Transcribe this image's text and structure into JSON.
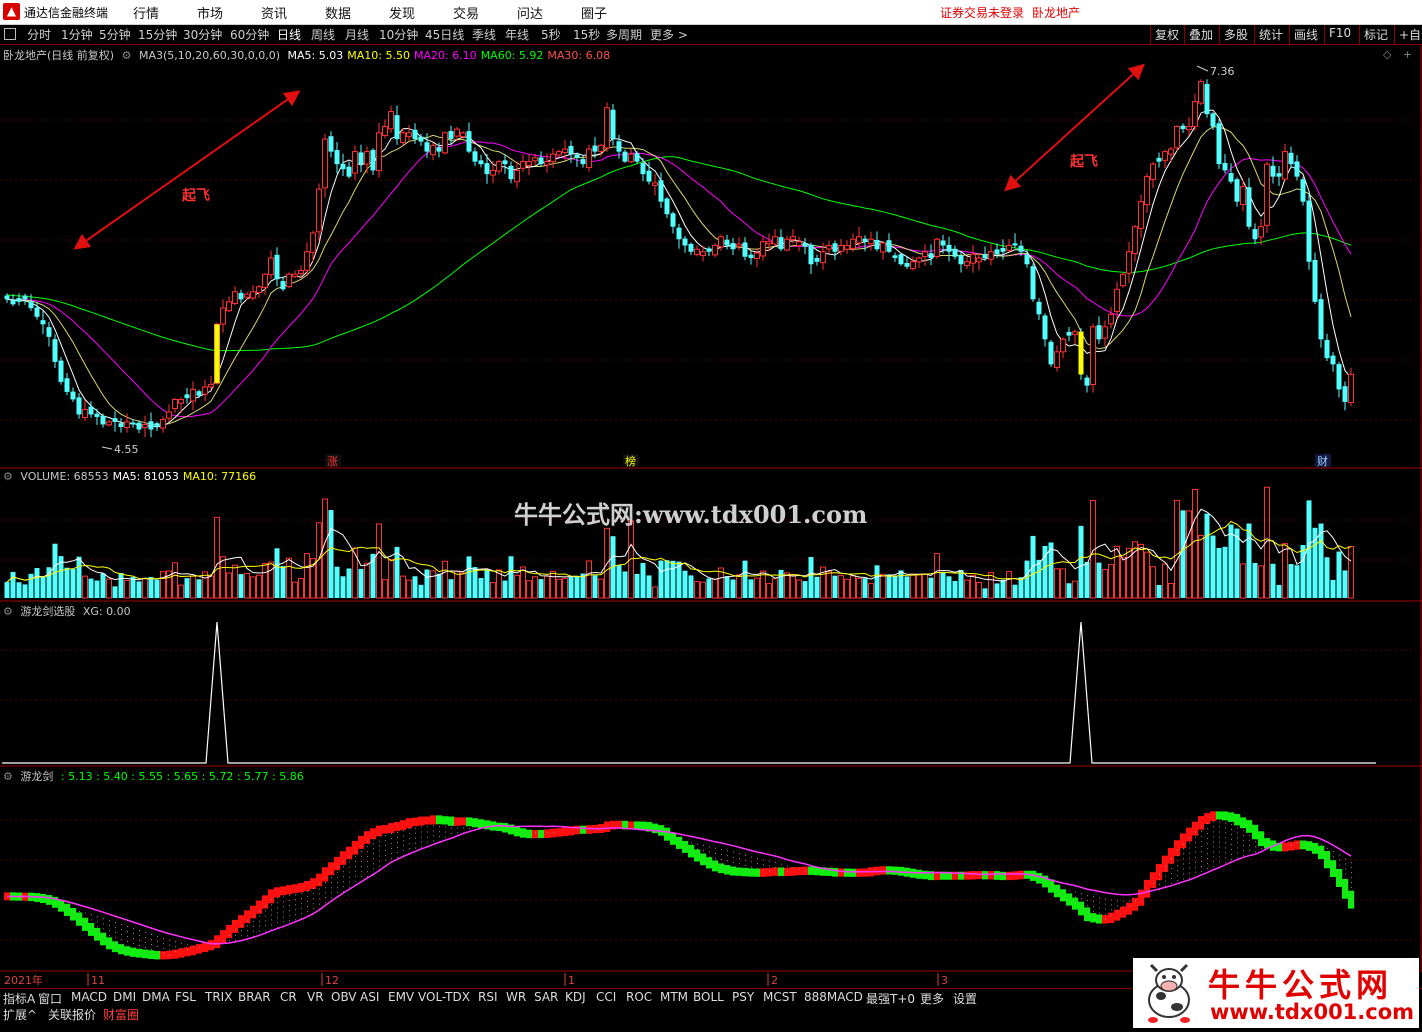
{
  "titlebar": {
    "app_name": "通达信金融终端",
    "menu": [
      "行情",
      "市场",
      "资讯",
      "数据",
      "发现",
      "交易",
      "问达",
      "圈子"
    ],
    "login_status": "证券交易未登录",
    "stock_name": "卧龙地产"
  },
  "toolbar": {
    "periods": [
      "分时",
      "1分钟",
      "5分钟",
      "15分钟",
      "30分钟",
      "60分钟",
      "日线",
      "周线",
      "月线",
      "10分钟",
      "45日线",
      "季线",
      "年线",
      "5秒",
      "15秒",
      "多周期",
      "更多 >"
    ],
    "active_period": "日线",
    "right": [
      "复权",
      "叠加",
      "多股",
      "统计",
      "画线",
      "F10",
      "标记",
      "+自选"
    ]
  },
  "main_legend": {
    "title": "卧龙地产(日线 前复权)",
    "ma_param": "MA3(5,10,20,60,30,0,0,0)",
    "items": [
      {
        "label": "MA5: 5.03",
        "color": "#ffffff"
      },
      {
        "label": "MA10: 5.50",
        "color": "#ffff00"
      },
      {
        "label": "MA20: 6.10",
        "color": "#ff00ff"
      },
      {
        "label": "MA60: 5.92",
        "color": "#00ff00"
      },
      {
        "label": "MA30: 6.08",
        "color": "#ff5050"
      }
    ]
  },
  "volume_legend": {
    "items": [
      {
        "label": "VOLUME: 68553",
        "color": "#c8c8c8"
      },
      {
        "label": "MA5: 81053",
        "color": "#ffffff"
      },
      {
        "label": "MA10: 77166",
        "color": "#ffff00"
      }
    ]
  },
  "xg_legend": {
    "label": "游龙剑选股",
    "value": "XG: 0.00"
  },
  "ylj_legend": {
    "label": "游龙剑",
    "values": ": 5.13 : 5.40 : 5.55 : 5.65 : 5.72 : 5.77 : 5.86"
  },
  "annotations": {
    "takeoff_1": "起飞",
    "takeoff_2": "起飞",
    "high_label": "7.36",
    "low_label": "4.55",
    "marker_zhang": "涨",
    "marker_bang": "榜",
    "marker_cai": "财"
  },
  "watermark": "牛牛公式网:www.tdx001.com",
  "date_axis": [
    "2021年",
    "11",
    "12",
    "1",
    "2",
    "3"
  ],
  "bottom_tabs": [
    "指标A",
    "窗口",
    "MACD",
    "DMI",
    "DMA",
    "FSL",
    "TRIX",
    "BRAR",
    "CR",
    "VR",
    "OBV",
    "ASI",
    "EMV",
    "VOL-TDX",
    "RSI",
    "WR",
    "SAR",
    "KDJ",
    "CCI",
    "ROC",
    "MTM",
    "BOLL",
    "PSY",
    "MCST",
    "888MACD",
    "最强T+0",
    "更多",
    "设置"
  ],
  "bottom_tabs2": [
    "扩展^",
    "关联报价",
    "财富圈"
  ],
  "promo": {
    "title": "牛牛公式网",
    "url": "www.tdx001.com"
  },
  "colors": {
    "up": "#ff3333",
    "down": "#54ffff",
    "ma5": "#ffffff",
    "ma10": "#ffff00",
    "ma20": "#ff00ff",
    "ma60": "#00ff00",
    "background": "#000000"
  },
  "chart_data": {
    "type": "candlestick",
    "title": "卧龙地产(日线 前复权)",
    "period": "日线",
    "price_range": [
      4.4,
      7.5
    ],
    "annotated_high": 7.36,
    "annotated_low": 4.55,
    "last_values": {
      "MA5": 5.03,
      "MA10": 5.5,
      "MA20": 6.1,
      "MA60": 5.92,
      "MA30": 6.08
    },
    "volume_last": {
      "VOLUME": 68553,
      "MA5": 81053,
      "MA10": 77166
    },
    "xg_signal_bars": [
      35,
      179
    ],
    "xg_current": 0.0,
    "ylj_current": [
      5.13,
      5.4,
      5.55,
      5.65,
      5.72,
      5.77,
      5.86
    ],
    "close": [
      5.62,
      5.58,
      5.6,
      5.62,
      5.55,
      5.48,
      5.42,
      5.32,
      5.12,
      4.96,
      4.88,
      4.82,
      4.7,
      4.74,
      4.7,
      4.68,
      4.62,
      4.64,
      4.64,
      4.6,
      4.64,
      4.62,
      4.58,
      4.62,
      4.58,
      4.6,
      4.66,
      4.72,
      4.82,
      4.82,
      4.83,
      4.9,
      4.85,
      4.92,
      4.94,
      5.42,
      5.55,
      5.6,
      5.68,
      5.62,
      5.66,
      5.68,
      5.72,
      5.82,
      5.95,
      5.78,
      5.7,
      5.82,
      5.82,
      5.85,
      6.0,
      6.15,
      6.5,
      6.9,
      6.8,
      6.7,
      6.66,
      6.6,
      6.8,
      6.7,
      6.8,
      6.65,
      6.95,
      7.0,
      7.12,
      6.9,
      6.95,
      6.95,
      6.9,
      6.88,
      6.8,
      6.85,
      6.8,
      6.95,
      6.9,
      6.98,
      6.95,
      6.8,
      6.72,
      6.7,
      6.62,
      6.65,
      6.72,
      6.7,
      6.58,
      6.65,
      6.72,
      6.72,
      6.75,
      6.7,
      6.72,
      6.78,
      6.8,
      6.82,
      6.78,
      6.75,
      6.7,
      6.82,
      6.8,
      6.85,
      7.15,
      6.9,
      6.8,
      6.72,
      6.78,
      6.72,
      6.62,
      6.56,
      6.55,
      6.4,
      6.3,
      6.2,
      6.1,
      6.05,
      6.0,
      6.02,
      6.0,
      6.0,
      6.05,
      6.12,
      6.05,
      6.02,
      6.06,
      5.96,
      5.95,
      5.99,
      6.08,
      6.08,
      6.12,
      6.02,
      6.1,
      6.12,
      6.08,
      6.04,
      5.9,
      5.92,
      6.0,
      6.05,
      6.0,
      6.05,
      6.05,
      6.1,
      6.12,
      6.08,
      6.1,
      6.02,
      6.07,
      6.0,
      5.95,
      5.9,
      5.88,
      5.92,
      5.95,
      6.0,
      5.95,
      6.1,
      6.05,
      6.0,
      5.96,
      5.9,
      5.92,
      5.98,
      5.95,
      5.95,
      6.0,
      5.98,
      6.0,
      6.05,
      6.05,
      6.0,
      5.9,
      5.62,
      5.5,
      5.3,
      5.1,
      5.2,
      5.3,
      5.33,
      5.36,
      5.02,
      4.93,
      5.4,
      5.3,
      5.4,
      5.5,
      5.7,
      5.82,
      6.0,
      6.2,
      6.4,
      6.6,
      6.7,
      6.72,
      6.8,
      6.82,
      7.0,
      6.98,
      7.0,
      7.2,
      7.36,
      7.1,
      7.0,
      6.7,
      6.65,
      6.56,
      6.4,
      6.52,
      6.2,
      6.1,
      6.2,
      6.7,
      6.6,
      6.6,
      6.8,
      6.7,
      6.6,
      6.4,
      5.92,
      5.6,
      5.3,
      5.15,
      5.1,
      4.9,
      4.8,
      5.02
    ]
  }
}
